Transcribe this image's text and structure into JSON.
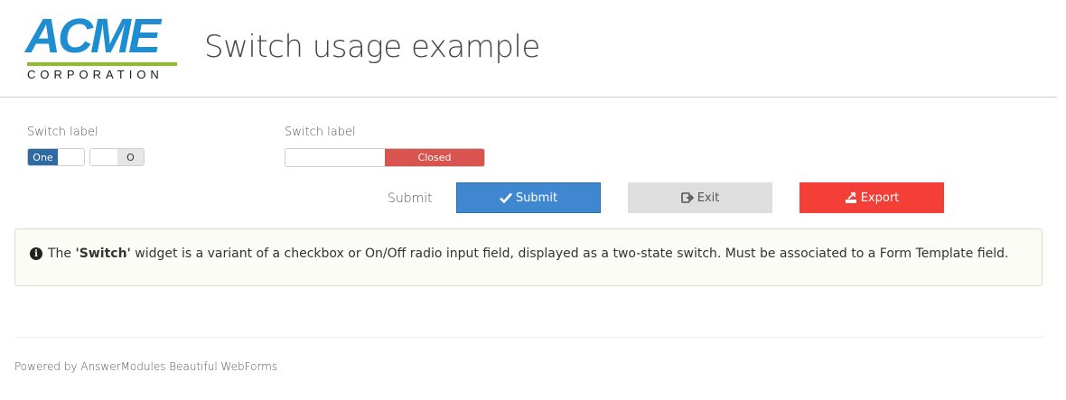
{
  "header": {
    "logo": {
      "brand": "ACME",
      "sub": "CORPORATION",
      "bar_color": "#8cbd2b",
      "brand_color": "#1f8ed0"
    },
    "title": "Switch usage example"
  },
  "fields": {
    "switch_a": {
      "label": "Switch label",
      "option_on": "One",
      "option_off": "O",
      "accent": "#2e6aa3"
    },
    "switch_b": {
      "label": "Switch label",
      "state_text": "Closed",
      "accent": "#d9534f"
    }
  },
  "actions": {
    "submit_label": "Submit",
    "buttons": {
      "submit": {
        "label": "Submit",
        "icon": "check-icon",
        "color": "#3f88cf"
      },
      "exit": {
        "label": "Exit",
        "icon": "exit-icon",
        "color": "#dedede"
      },
      "export": {
        "label": "Export",
        "icon": "export-icon",
        "color": "#f33f37"
      }
    }
  },
  "info": {
    "icon": "info-icon",
    "prefix": "The ",
    "highlight": "'Switch'",
    "text": " widget is a variant of a checkbox or On/Off radio input field, displayed as a two-state switch. Must be associated to a Form Template field."
  },
  "footer": {
    "text": "Powered by AnswerModules Beautiful WebForms"
  }
}
